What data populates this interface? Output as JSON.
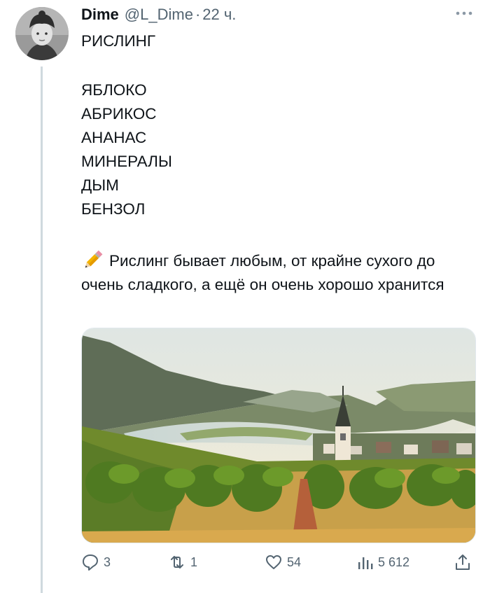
{
  "tweet": {
    "author_name": "Dime",
    "handle": "@L_Dime",
    "separator": "·",
    "time": "22 ч.",
    "title": "РИСЛИНГ",
    "notes": [
      "ЯБЛОКО",
      "АБРИКОС",
      "АНАНАС",
      "МИНЕРАЛЫ",
      "ДЫМ",
      "БЕНЗОЛ"
    ],
    "description": "Рислинг бывает любым, от крайне сухого до очень сладкого, а ещё он очень хорошо хранится",
    "emoji_icon": "pencil-icon"
  },
  "actions": {
    "replies": "3",
    "retweets": "1",
    "likes": "54",
    "views": "5 612"
  },
  "colors": {
    "text": "#0f1419",
    "muted": "#536471",
    "thread_line": "#cfd9de"
  }
}
